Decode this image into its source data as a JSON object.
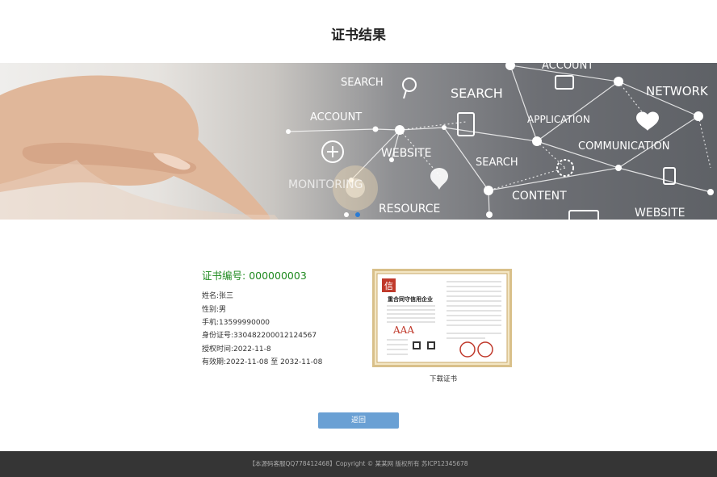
{
  "page": {
    "title": "证书结果"
  },
  "banner": {
    "labels": [
      "SEARCH",
      "ACCOUNT",
      "SEARCH",
      "APPLICATION",
      "NETWORK",
      "WEBSITE",
      "COMMUNICATION",
      "MONITORING",
      "SEARCH",
      "CONTENT",
      "RESOURCE",
      "WEBSITE",
      "ACCOUNT"
    ],
    "slide_count": 2,
    "active_slide": 2,
    "colors": {
      "dot_inactive": "#ffffff",
      "dot_active": "#2a7bd4"
    }
  },
  "certificate": {
    "number_label": "证书编号:",
    "number_value": "000000003",
    "fields": [
      {
        "label": "姓名:",
        "value": "张三"
      },
      {
        "label": "性别:",
        "value": "男"
      },
      {
        "label": "手机:",
        "value": "13599990000"
      },
      {
        "label": "身份证号:",
        "value": "330482200012124567"
      },
      {
        "label": "授权时间:",
        "value": "2022-11-8"
      },
      {
        "label": "有效期:",
        "value": "2022-11-08 至 2032-11-08"
      }
    ],
    "image": {
      "heading": "重合同守信用企业",
      "grade": "AAA",
      "seal_char": "信"
    },
    "download_label": "下载证书"
  },
  "actions": {
    "back_label": "返回"
  },
  "footer": {
    "text": "【本源码客服QQ778412468】Copyright © 某某网 版权所有 苏ICP12345678"
  },
  "colors": {
    "accent_green": "#1f8a1f",
    "button_blue": "#6aa0d4",
    "footer_bg": "#353535"
  }
}
